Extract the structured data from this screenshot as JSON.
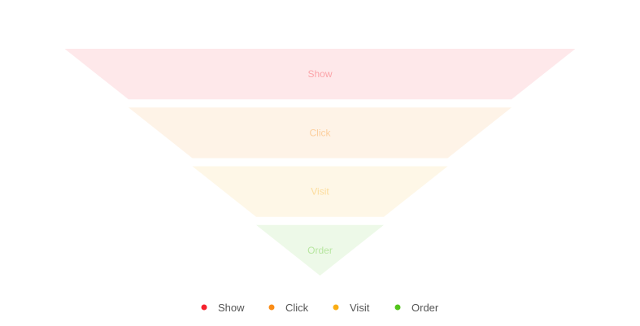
{
  "chart_data": {
    "type": "funnel",
    "title": "",
    "stages": [
      {
        "name": "Show",
        "value": 100,
        "color": "#f5222d"
      },
      {
        "name": "Click",
        "value": 75,
        "color": "#fa8c16"
      },
      {
        "name": "Visit",
        "value": 50,
        "color": "#faad14"
      },
      {
        "name": "Order",
        "value": 25,
        "color": "#52c41a"
      }
    ],
    "legend": {
      "position": "bottom",
      "items": [
        "Show",
        "Click",
        "Visit",
        "Order"
      ]
    },
    "shape": "inverted-pyramid",
    "series_opacity": 0.1
  }
}
